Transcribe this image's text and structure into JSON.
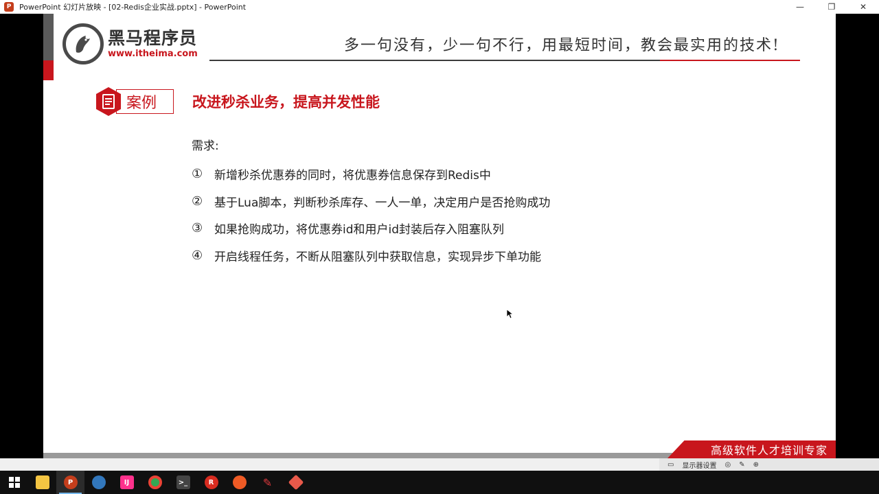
{
  "window": {
    "title": "PowerPoint 幻灯片放映 - [02-Redis企业实战.pptx] - PowerPoint",
    "minimize_glyph": "—",
    "maximize_glyph": "❐",
    "close_glyph": "✕"
  },
  "slide": {
    "logo": {
      "name": "黑马程序员",
      "url": "www.itheima.com"
    },
    "slogan": "多一句没有，少一句不行，用最短时间，教会最实用的技术!",
    "case_label": "案例",
    "case_title": "改进秒杀业务，提高并发性能",
    "requirements_label": "需求:",
    "requirements": [
      {
        "num": "①",
        "text": "新增秒杀优惠券的同时，将优惠券信息保存到Redis中"
      },
      {
        "num": "②",
        "text": "基于Lua脚本，判断秒杀库存、一人一单，决定用户是否抢购成功"
      },
      {
        "num": "③",
        "text": "如果抢购成功，将优惠券id和用户id封装后存入阻塞队列"
      },
      {
        "num": "④",
        "text": "开启线程任务，不断从阻塞队列中获取信息，实现异步下单功能"
      }
    ],
    "footer_tag": "高级软件人才培训专家"
  },
  "statusbar": {
    "presenter_view": "显示器设置"
  },
  "taskbar": {
    "items": [
      {
        "icon": "windows-start-icon",
        "color": "#ffffff"
      },
      {
        "icon": "file-explorer-icon",
        "color": "#f4c542"
      },
      {
        "icon": "powerpoint-icon",
        "color": "#c43e1c"
      },
      {
        "icon": "browser-icon",
        "color": "#3277bc"
      },
      {
        "icon": "intellij-icon",
        "color": "#ff318c"
      },
      {
        "icon": "chrome-icon",
        "color": "#34a853"
      },
      {
        "icon": "terminal-icon",
        "color": "#444444"
      },
      {
        "icon": "redis-icon",
        "color": "#d82c20"
      },
      {
        "icon": "postman-icon",
        "color": "#ef5b25"
      },
      {
        "icon": "pen-icon",
        "color": "#e03a3e"
      },
      {
        "icon": "app-icon",
        "color": "#e8594a"
      }
    ]
  },
  "colors": {
    "accent_red": "#c8161d",
    "dark_gray": "#3b3b3b"
  }
}
